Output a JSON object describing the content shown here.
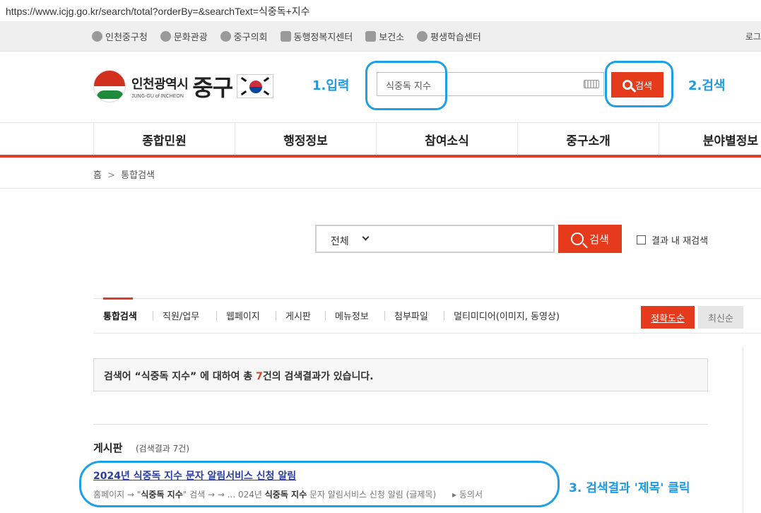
{
  "browser": {
    "url": "https://www.icjg.go.kr/search/total?orderBy=&searchText=식중독+지수"
  },
  "topbar": {
    "links": [
      "인천중구청",
      "문화관광",
      "중구의회",
      "동행정복지센터",
      "보건소",
      "평생학습센터"
    ],
    "login": "로그"
  },
  "header": {
    "logo_city": "인천광역시",
    "logo_english": "JUNG-GU of INCHEON",
    "logo_gu": "중구",
    "search_value": "식중독 지수",
    "search_button": "검색"
  },
  "annotations": {
    "step1": "1.입력",
    "step2": "2.검색",
    "step3": "3. 검색결과 '제목' 클릭"
  },
  "gnb": [
    "종합민원",
    "행정정보",
    "참여소식",
    "중구소개",
    "분야별정보"
  ],
  "breadcrumb": {
    "home": "홈",
    "sep": ">",
    "current": "통합검색"
  },
  "search": {
    "scope": "전체",
    "button": "검색",
    "research_label": "결과 내 재검색"
  },
  "tabs": [
    "통합검색",
    "직원/업무",
    "웹페이지",
    "게시판",
    "메뉴정보",
    "첨부파일",
    "멀티미디어(이미지, 동영상)"
  ],
  "sort": {
    "accuracy": "정확도순",
    "latest": "최신순"
  },
  "summary": {
    "prefix": "검색어 “식중독 지수” 에 대하여 총 ",
    "count": "7",
    "suffix": "건의 검색결과가 있습니다."
  },
  "board": {
    "title": "게시판",
    "count": "(검색결과 7건)",
    "result_title": "2024년 식중독 지수 문자 알림서비스 신청 알림",
    "path": {
      "p1": "홈페이지 →  \"",
      "k1": "식중독 지수",
      "p2": "\" 검색 →  → ... 024년 ",
      "k2": "식중독 지수",
      "p3": " 문자 알림서비스 신청 알림 (글제목)      ▸ 동의서"
    }
  },
  "colors": {
    "accent": "#e63a1c",
    "annotation": "#1e9be0",
    "link": "#2a3fa0"
  }
}
